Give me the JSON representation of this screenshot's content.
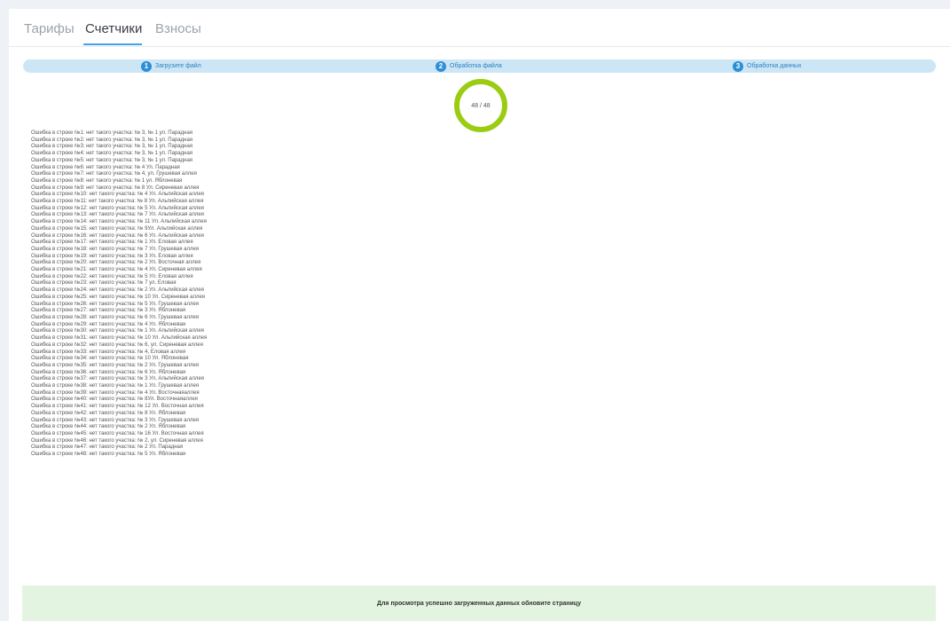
{
  "tabs": {
    "tariffs": "Тарифы",
    "meters": "Счетчики",
    "fees": "Взносы"
  },
  "steps": [
    {
      "num": "1",
      "label": "Загрузите файл"
    },
    {
      "num": "2",
      "label": "Обработка файла"
    },
    {
      "num": "3",
      "label": "Обработка данных"
    }
  ],
  "progress": {
    "text": "48 / 48",
    "done": 48,
    "total": 48,
    "ring_color": "#9acd12"
  },
  "errors": [
    "Ошибка в строке №1: нет такого участка: № 3, № 1 ул. Парадная",
    "Ошибка в строке №2: нет такого участка: № 3, № 1 ул. Парадная",
    "Ошибка в строке №3: нет такого участка: № 3, № 1 ул. Парадная",
    "Ошибка в строке №4: нет такого участка: № 3, № 1 ул. Парадная",
    "Ошибка в строке №5: нет такого участка: № 3, № 1 ул. Парадная",
    "Ошибка в строке №6: нет такого участка: № 4 Ул. Парадная",
    "Ошибка в строке №7: нет такого участка: № 4, ул. Грушевая аллея",
    "Ошибка в строке №8: нет такого участка: № 1 ул. Яблоневая",
    "Ошибка в строке №9: нет такого участка: № 8 Ул. Сиреневая аллея",
    "Ошибка в строке №10: нет такого участка: № 4 Ул. Альпийская аллея",
    "Ошибка в строке №11: нет такого участка: № 8 Ул. Альпийская аллея",
    "Ошибка в строке №12: нет такого участка: № 5 Ул. Альпийская аллея",
    "Ошибка в строке №13: нет такого участка: № 7 Ул. Альпийская аллея",
    "Ошибка в строке №14: нет такого участка: № 11 Ул. Альпийская аллея",
    "Ошибка в строке №15: нет такого участка: № 9Ул. Альпийская аллея",
    "Ошибка в строке №16: нет такого участка: № 6 Ул. Альпийская аллея",
    "Ошибка в строке №17: нет такого участка: № 1 Ул. Еловая аллея",
    "Ошибка в строке №18: нет такого участка: № 7 Ул. Грушевая аллея",
    "Ошибка в строке №19: нет такого участка: № 3 Ул. Еловая аллея",
    "Ошибка в строке №20: нет такого участка: № 2 Ул. Восточная аллея",
    "Ошибка в строке №21: нет такого участка: № 4 Ул. Сиреневая аллея",
    "Ошибка в строке №22: нет такого участка: № 5 Ул. Еловая аллея",
    "Ошибка в строке №23: нет такого участка: № 7 ул. Еловая",
    "Ошибка в строке №24: нет такого участка: № 2 Ул. Альпийская аллея",
    "Ошибка в строке №25: нет такого участка: № 10 Ул. Сиреневая аллея",
    "Ошибка в строке №26: нет такого участка: № 5 Ул. Грушевая аллея",
    "Ошибка в строке №27: нет такого участка: № 3 Ул. Яблоневая",
    "Ошибка в строке №28: нет такого участка: № 6 Ул. Грушевая аллея",
    "Ошибка в строке №29: нет такого участка: № 4 Ул. Яблоневая",
    "Ошибка в строке №30: нет такого участка: № 1 Ул. Альпийская аллея",
    "Ошибка в строке №31: нет такого участка: № 10 Ул. Альпийская аллея",
    "Ошибка в строке №32: нет такого участка: № 6, ул. Сиреневая аллея",
    "Ошибка в строке №33: нет такого участка: № 4, Еловая аллея",
    "Ошибка в строке №34: нет такого участка: № 10 Ул. Яблоневая",
    "Ошибка в строке №35: нет такого участка: № 2 Ул. Грушевая аллея",
    "Ошибка в строке №36: нет такого участка: № 6 Ул. Яблоневая",
    "Ошибка в строке №37: нет такого участка: № 3 Ул. Альпийская аллея",
    "Ошибка в строке №38: нет такого участка: № 1 Ул. Грушевая аллея",
    "Ошибка в строке №39: нет такого участка: № 4 Ул. Восточнаяаллея",
    "Ошибка в строке №40: нет такого участка: № 8Ул. Восточнаяаллея",
    "Ошибка в строке №41: нет такого участка: № 12 Ул. Восточная аллея",
    "Ошибка в строке №42: нет такого участка: № 8 Ул. Яблоневая",
    "Ошибка в строке №43: нет такого участка: № 3 Ул. Грушевая аллея",
    "Ошибка в строке №44: нет такого участка: № 2 Ул. Яблоневая",
    "Ошибка в строке №45: нет такого участка: № 16 Ул. Восточная аллея",
    "Ошибка в строке №46: нет такого участка: № 2, ул. Сиреневая аллея",
    "Ошибка в строке №47: нет такого участка: № 2 Ул. Парадная",
    "Ошибка в строке №48: нет такого участка: № 5 Ул. Яблоневая"
  ],
  "notice": "Для просмотра успешно загруженных данных обновите страницу"
}
